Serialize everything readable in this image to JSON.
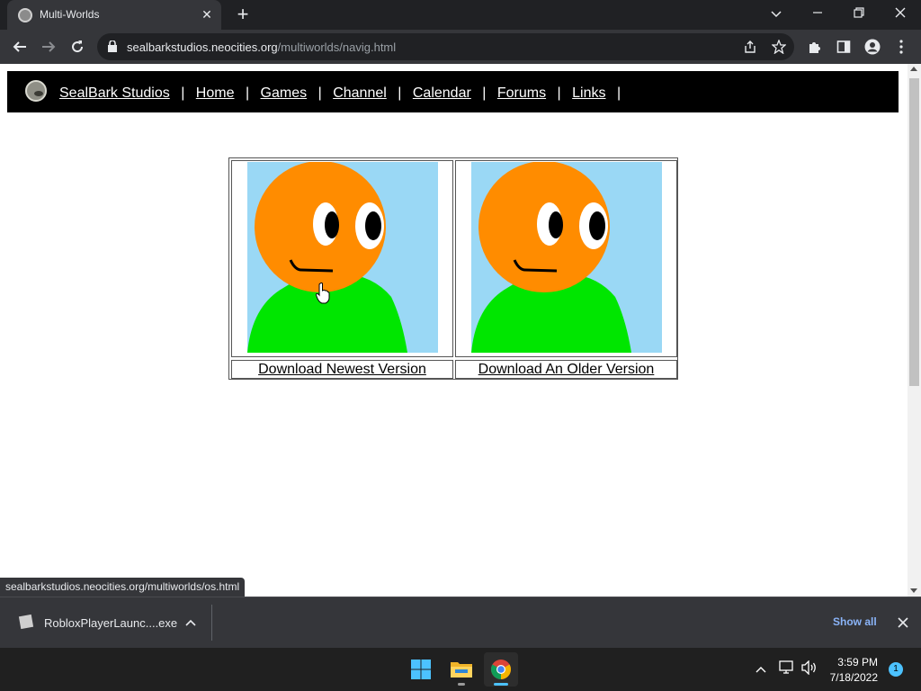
{
  "browser": {
    "tab_title": "Multi-Worlds",
    "url_host": "sealbarkstudios.neocities.org",
    "url_path": "/multiworlds/navig.html"
  },
  "site": {
    "brand": "SealBark Studios",
    "nav": [
      "Home",
      "Games",
      "Channel",
      "Calendar",
      "Forums",
      "Links"
    ],
    "separator": "|"
  },
  "downloads_table": {
    "items": [
      {
        "label": "Download Newest Version"
      },
      {
        "label": "Download An Older Version"
      }
    ]
  },
  "status_bar": {
    "url": "sealbarkstudios.neocities.org/multiworlds/os.html"
  },
  "download_shelf": {
    "file_name": "RobloxPlayerLaunc....exe",
    "show_all": "Show all"
  },
  "taskbar": {
    "time": "3:59 PM",
    "date": "7/18/2022",
    "notification_count": "1"
  },
  "colors": {
    "sky": "#9ad8f5",
    "head": "#ff8c00",
    "body": "#00e600",
    "accent_link": "#8ab4f8"
  }
}
